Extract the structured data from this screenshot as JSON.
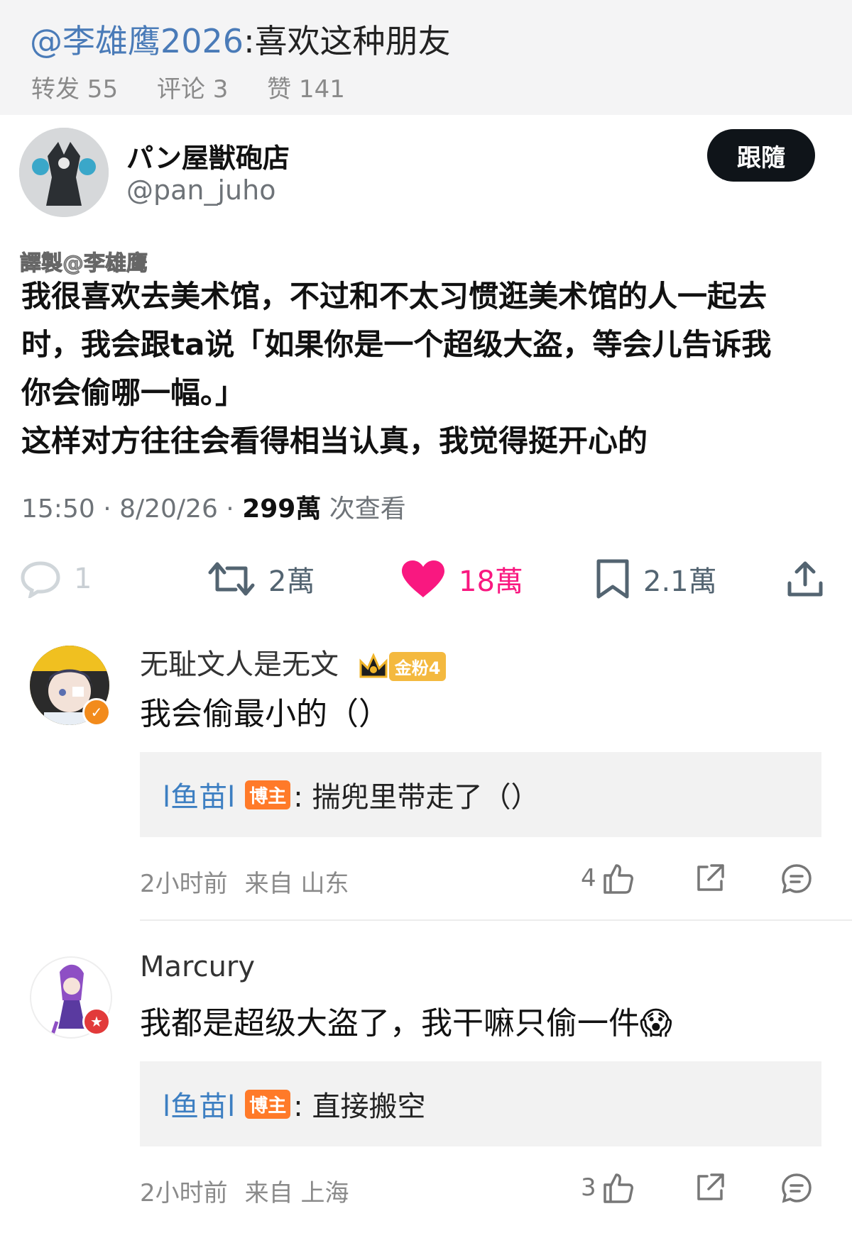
{
  "header": {
    "mention": "@李雄鹰2026",
    "text": ":喜欢这种朋友",
    "reposts": "转发 55",
    "comments": "评论 3",
    "likes": "赞 141"
  },
  "tweet": {
    "display_name": "パン屋獣砲店",
    "handle": "@pan_juho",
    "follow_label": "跟隨",
    "translator_tag": "譯製@李雄鹰",
    "body": [
      "我很喜欢去美术馆，不过和不太习惯逛美术馆的人一起去",
      "时，我会跟ta说「如果你是一个超级大盗，等会儿告诉我",
      "你会偷哪一幅。」",
      "这样对方往往会看得相当认真，我觉得挺开心的"
    ],
    "time": "15:50 · 8/20/26 · ",
    "views": "299萬",
    "views_suffix": " 次查看",
    "actions": {
      "replies": "1",
      "retweets": "2萬",
      "likes": "18萬",
      "bookmarks": "2.1萬"
    }
  },
  "comments": [
    {
      "name": "无耻文人是无文",
      "fan_badge": "金粉4",
      "text": "我会偷最小的（）",
      "reply_user": "l鱼苗l",
      "reply_badge": "博主",
      "reply_text": ": 揣兜里带走了（）",
      "time": "2小时前",
      "location": "来自 山东",
      "likes": "4"
    },
    {
      "name": "Marcury",
      "text": "我都是超级大盗了，我干嘛只偷一件",
      "emoji": "😱",
      "reply_user": "l鱼苗l",
      "reply_badge": "博主",
      "reply_text": ": 直接搬空",
      "time": "2小时前",
      "location": "来自 上海",
      "likes": "3"
    }
  ],
  "colors": {
    "like_pink": "#f91880",
    "mention_blue": "#4a7bb8",
    "host_orange": "#ff7a29"
  }
}
